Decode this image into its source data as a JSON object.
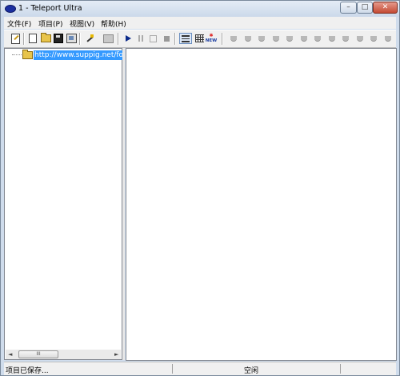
{
  "window": {
    "title": "1 - Teleport Ultra",
    "controls": {
      "minimize": "–",
      "maximize": "□",
      "close": "✕"
    }
  },
  "menu": [
    "文件(F)",
    "项目(P)",
    "视图(V)",
    "帮助(H)"
  ],
  "toolbar": {
    "icons": [
      "edit-project-icon",
      "new-document-icon",
      "open-folder-icon",
      "save-disk-icon",
      "properties-icon",
      "wizard-wand-icon",
      "find-icon",
      "play-icon",
      "pause-icon",
      "stop-icon",
      "stop-filled-icon",
      "list-view-icon",
      "grid-view-icon",
      "new-badge-icon"
    ],
    "new_badge_text": "NEW",
    "thread_slots": 12
  },
  "tree": {
    "root_label": "http://www.suppig.net/foru"
  },
  "scrollbar": {
    "left": "◄",
    "right": "►",
    "grip": "III"
  },
  "status": {
    "left": "项目已保存...",
    "right": "空闲"
  }
}
